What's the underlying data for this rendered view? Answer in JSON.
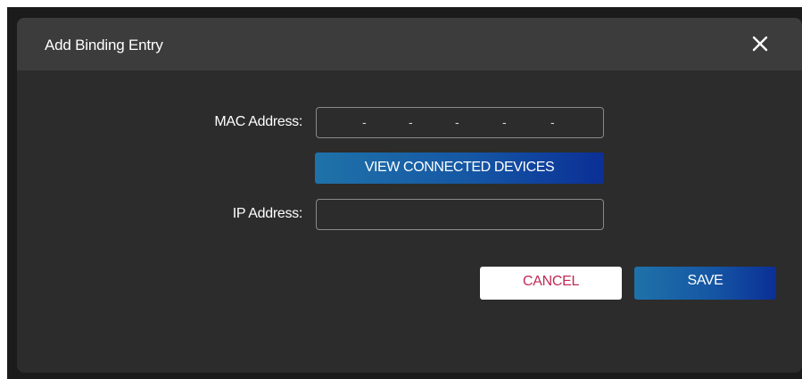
{
  "dialog": {
    "title": "Add Binding Entry",
    "close_icon": "close-icon"
  },
  "form": {
    "mac_label": "MAC Address:",
    "mac_separators": [
      "-",
      "-",
      "-",
      "-",
      "-"
    ],
    "view_devices_label": "VIEW CONNECTED DEVICES",
    "ip_label": "IP Address:",
    "ip_value": ""
  },
  "actions": {
    "cancel_label": "CANCEL",
    "save_label": "SAVE"
  },
  "colors": {
    "dialog_bg": "#2c2c2c",
    "header_bg": "#3c3c3c",
    "primary_gradient_start": "#1f72a9",
    "primary_gradient_end": "#0b2f96",
    "cancel_text": "#c02a55"
  }
}
